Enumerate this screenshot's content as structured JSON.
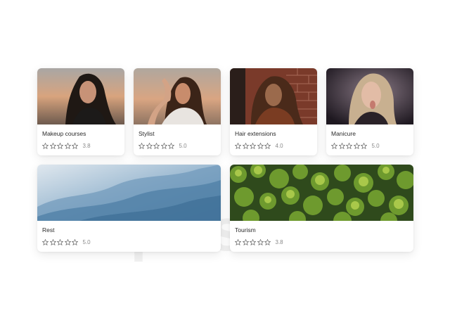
{
  "watermark_text": "farpost.ru",
  "cards": [
    {
      "title": "Makeup courses",
      "rating": "3.8",
      "stars": 0,
      "image": "woman-portrait-sunset"
    },
    {
      "title": "Stylist",
      "rating": "5.0",
      "stars": 0,
      "image": "woman-portrait-hand-in-hair"
    },
    {
      "title": "Hair extensions",
      "rating": "4.0",
      "stars": 0,
      "image": "woman-portrait-brick-wall"
    },
    {
      "title": "Manicure",
      "rating": "5.0",
      "stars": 0,
      "image": "woman-portrait-dark"
    },
    {
      "title": "Rest",
      "rating": "5.0",
      "stars": 0,
      "image": "misty-blue-mountains"
    },
    {
      "title": "Tourism",
      "rating": "3.8",
      "stars": 0,
      "image": "green-forest-aerial"
    }
  ],
  "colors": {
    "star_outline": "#6b6b6b",
    "rating_text": "#8a8a8a",
    "title_text": "#2a2a2a"
  }
}
